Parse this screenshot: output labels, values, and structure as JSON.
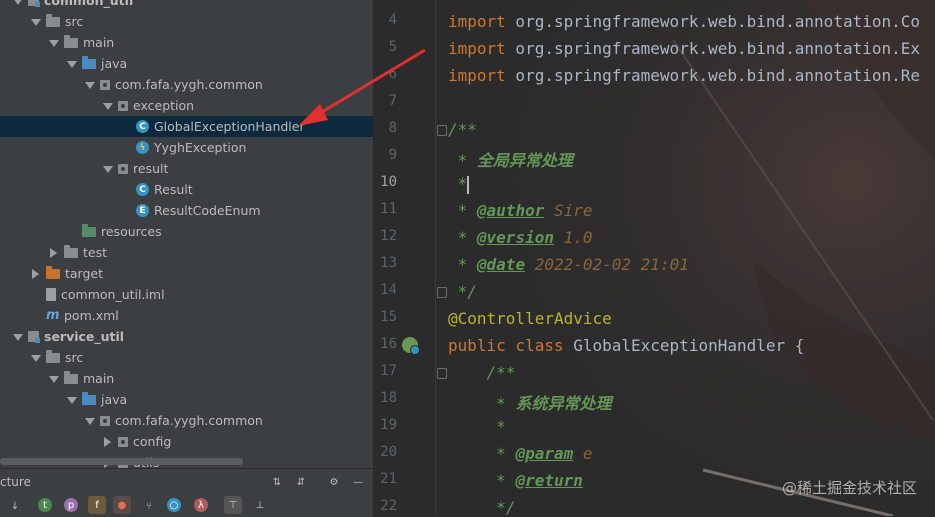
{
  "project_tree": {
    "items": [
      {
        "label": "common_util",
        "depth": 1,
        "expanded": true,
        "icon": "module-icon",
        "bold": true
      },
      {
        "label": "src",
        "depth": 2,
        "expanded": true,
        "icon": "folder-icon"
      },
      {
        "label": "main",
        "depth": 3,
        "expanded": true,
        "icon": "folder-icon"
      },
      {
        "label": "java",
        "depth": 4,
        "expanded": true,
        "icon": "source-folder-icon"
      },
      {
        "label": "com.fafa.yygh.common",
        "depth": 5,
        "expanded": true,
        "icon": "package-icon"
      },
      {
        "label": "exception",
        "depth": 6,
        "expanded": true,
        "icon": "package-icon"
      },
      {
        "label": "GlobalExceptionHandler",
        "depth": 7,
        "icon": "class-icon",
        "selected": true
      },
      {
        "label": "YyghException",
        "depth": 7,
        "icon": "exception-class-icon"
      },
      {
        "label": "result",
        "depth": 6,
        "expanded": true,
        "icon": "package-icon"
      },
      {
        "label": "Result",
        "depth": 7,
        "icon": "class-icon"
      },
      {
        "label": "ResultCodeEnum",
        "depth": 7,
        "icon": "enum-icon"
      },
      {
        "label": "resources",
        "depth": 4,
        "icon": "resources-folder-icon"
      },
      {
        "label": "test",
        "depth": 3,
        "expanded": false,
        "icon": "folder-icon"
      },
      {
        "label": "target",
        "depth": 2,
        "expanded": false,
        "icon": "target-folder-icon"
      },
      {
        "label": "common_util.iml",
        "depth": 2,
        "icon": "iml-file-icon"
      },
      {
        "label": "pom.xml",
        "depth": 2,
        "icon": "maven-icon"
      },
      {
        "label": "service_util",
        "depth": 1,
        "expanded": true,
        "icon": "module-icon",
        "bold": true
      },
      {
        "label": "src",
        "depth": 2,
        "expanded": true,
        "icon": "folder-icon"
      },
      {
        "label": "main",
        "depth": 3,
        "expanded": true,
        "icon": "folder-icon"
      },
      {
        "label": "java",
        "depth": 4,
        "expanded": true,
        "icon": "source-folder-icon"
      },
      {
        "label": "com.fafa.yygh.common",
        "depth": 5,
        "expanded": true,
        "icon": "package-icon"
      },
      {
        "label": "config",
        "depth": 6,
        "expanded": false,
        "icon": "package-icon"
      },
      {
        "label": "utils",
        "depth": 6,
        "expanded": false,
        "icon": "package-icon"
      }
    ]
  },
  "structure_panel": {
    "label": "cture"
  },
  "editor": {
    "current_line": 10,
    "lines": [
      {
        "n": "4"
      },
      {
        "n": "5"
      },
      {
        "n": "6"
      },
      {
        "n": "7"
      },
      {
        "n": "8"
      },
      {
        "n": "9"
      },
      {
        "n": "10"
      },
      {
        "n": "11"
      },
      {
        "n": "12"
      },
      {
        "n": "13"
      },
      {
        "n": "14"
      },
      {
        "n": "15"
      },
      {
        "n": "16"
      },
      {
        "n": "17"
      },
      {
        "n": "18"
      },
      {
        "n": "19"
      },
      {
        "n": "20"
      },
      {
        "n": "21"
      },
      {
        "n": "22"
      }
    ],
    "code": {
      "l4_kw": "import",
      "l4_rest": " org.springframework.web.bind.annotation.Co",
      "l5_kw": "import",
      "l5_rest": " org.springframework.web.bind.annotation.Ex",
      "l6_kw": "import",
      "l6_rest": " org.springframework.web.bind.annotation.Re",
      "l8": "/**",
      "l9_star": " * ",
      "l9_text": "全局异常处理",
      "l10_star": " *",
      "l11_star": " * ",
      "l11_tag": "@author",
      "l11_val": " Sire",
      "l12_star": " * ",
      "l12_tag": "@version",
      "l12_val": " 1.0",
      "l13_star": " * ",
      "l13_tag": "@date",
      "l13_val": " 2022-02-02 21:01",
      "l14": " */",
      "l15": "@ControllerAdvice",
      "l16_kw": "public class",
      "l16_rest": " GlobalExceptionHandler {",
      "l17": "    /**",
      "l18_star": "     * ",
      "l18_text": "系统异常处理",
      "l19": "     *",
      "l20_star": "     * ",
      "l20_tag": "@param",
      "l20_val": " e",
      "l21_star": "     * ",
      "l21_tag": "@return",
      "l22": "     */"
    }
  },
  "watermark": "@稀土掘金技术社区",
  "colors": {
    "keyword": "#cc7832",
    "comment": "#629755",
    "annotation": "#bbb529",
    "selection": "#0d293e",
    "arrow": "#e03030"
  }
}
